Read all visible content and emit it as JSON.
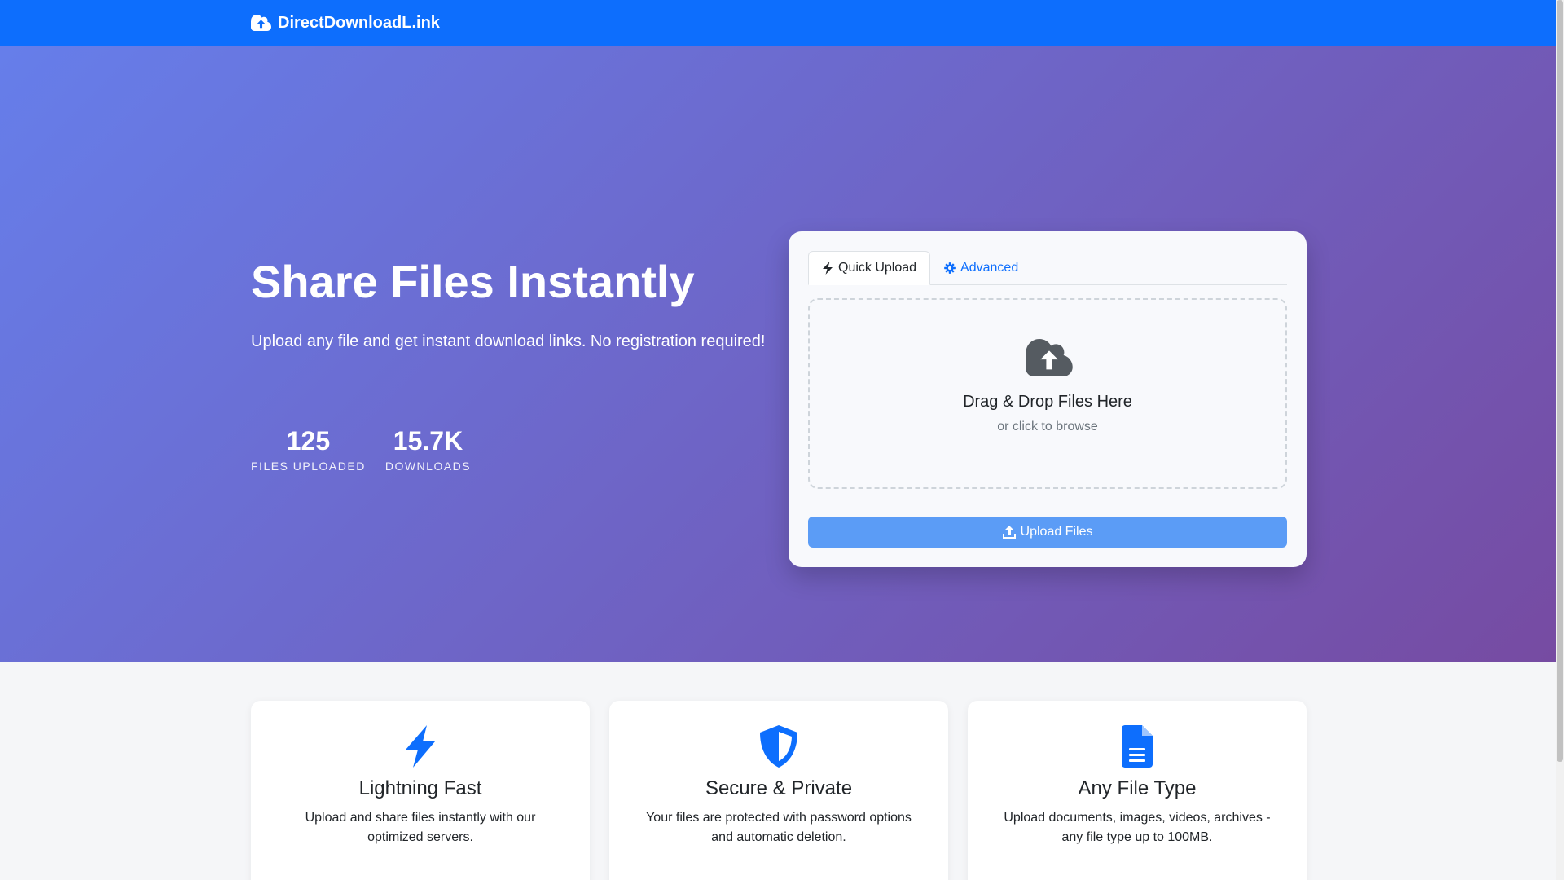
{
  "navbar": {
    "brand": "DirectDownloadL.ink",
    "brand_icon": "cloud-upload-icon"
  },
  "hero": {
    "title": "Share Files Instantly",
    "subtitle": "Upload any file and get instant download links. No registration required!",
    "stats": [
      {
        "value": "125",
        "label": "FILES UPLOADED"
      },
      {
        "value": "15.7K",
        "label": "DOWNLOADS"
      }
    ]
  },
  "upload": {
    "tabs": [
      {
        "label": "Quick Upload",
        "icon": "lightning-icon",
        "active": true
      },
      {
        "label": "Advanced",
        "icon": "gear-icon",
        "active": false
      }
    ],
    "dropzone": {
      "title": "Drag & Drop Files Here",
      "subtitle": "or click to browse",
      "icon": "cloud-upload-icon"
    },
    "button_label": "Upload Files"
  },
  "features": [
    {
      "icon": "lightning-icon",
      "title": "Lightning Fast",
      "description": "Upload and share files instantly with our optimized servers."
    },
    {
      "icon": "shield-icon",
      "title": "Secure & Private",
      "description": "Your files are protected with password options and automatic deletion."
    },
    {
      "icon": "file-icon",
      "title": "Any File Type",
      "description": "Upload documents, images, videos, archives - any file type up to 100MB."
    }
  ],
  "colors": {
    "primary": "#0d6efd",
    "gradient_start": "#667eea",
    "gradient_end": "#764ba2",
    "button": "#5b9cf6"
  }
}
